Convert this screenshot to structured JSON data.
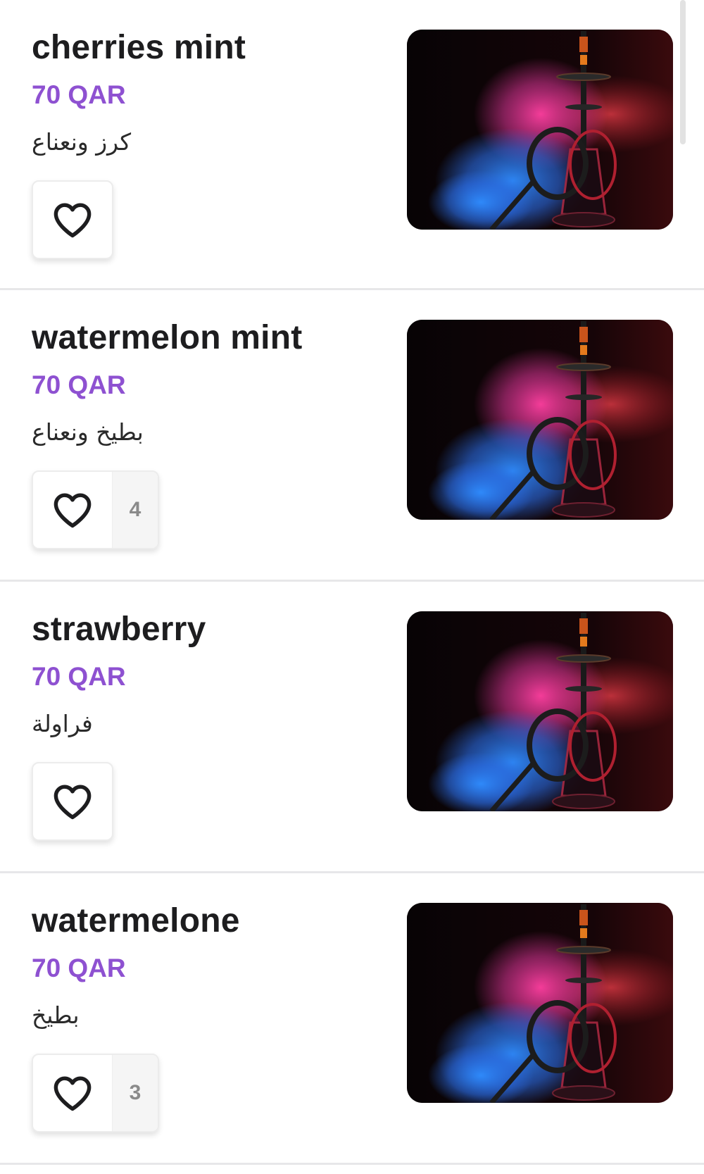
{
  "currency_color": "#8e51d1",
  "products": [
    {
      "name": "cherries mint",
      "price": "70 QAR",
      "arabic": "كرز ونعناع",
      "likes": null
    },
    {
      "name": "watermelon mint",
      "price": "70 QAR",
      "arabic": "بطيخ ونعناع",
      "likes": "4"
    },
    {
      "name": "strawberry",
      "price": "70 QAR",
      "arabic": "فراولة",
      "likes": null
    },
    {
      "name": "watermelone",
      "price": "70 QAR",
      "arabic": "بطيخ",
      "likes": "3"
    }
  ],
  "icons": {
    "like": "heart-icon",
    "image": "hookah-smoke-photo"
  }
}
